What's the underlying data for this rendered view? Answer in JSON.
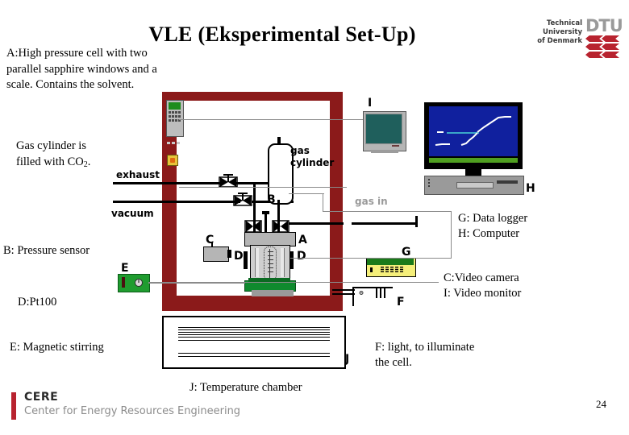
{
  "slide": {
    "title": "VLE (Eksperimental Set-Up)",
    "page_number": "24"
  },
  "branding": {
    "dtu": {
      "line1": "Technical University",
      "line2": "of Denmark",
      "letters": "DTU",
      "mark_color": "#b8232f",
      "letters_color": "#9a9a9a"
    },
    "cere": {
      "name": "CERE",
      "subtitle": "Center for Energy Resources Engineering",
      "bar_color": "#b8232f",
      "subtitle_color": "#8c8c8c"
    }
  },
  "notes": {
    "a": "A:High pressure cell with two parallel sapphire windows and a scale. Contains the solvent.",
    "gas_cylinder_1": "Gas cylinder is",
    "gas_cylinder_2a": "filled with CO",
    "gas_cylinder_2b": "2",
    "gas_cylinder_2c": ".",
    "b": "B: Pressure sensor",
    "d": "D:Pt100",
    "e": "E: Magnetic stirring",
    "j": "J: Temperature chamber",
    "g": "G: Data logger",
    "h": "H: Computer",
    "c": "C:Video camera",
    "i": "I: Video monitor",
    "f_line1": "F: light, to illuminate",
    "f_line2": "the cell."
  },
  "diagram": {
    "labels": {
      "exhaust": "exhaust",
      "vacuum": "vacuum",
      "gas_cylinder_1": "gas",
      "gas_cylinder_2": "cylinder",
      "gas_in": "gas in",
      "A": "A",
      "B": "B",
      "C": "C",
      "D_left": "D",
      "D_right": "D",
      "E": "E",
      "F": "F",
      "G": "G",
      "H": "H",
      "I": "I",
      "J": "J"
    },
    "colors": {
      "chamber": "#8b1a1a",
      "stirrer": "#0f8a2e",
      "logger_body": "#f5ef7a",
      "logger_top": "#1a7a1a",
      "pc_screen": "#10209e",
      "pc_strip": "#4f9f20",
      "video_screen": "#1f5f5c",
      "gas_in_text": "#9a9a9a"
    }
  }
}
